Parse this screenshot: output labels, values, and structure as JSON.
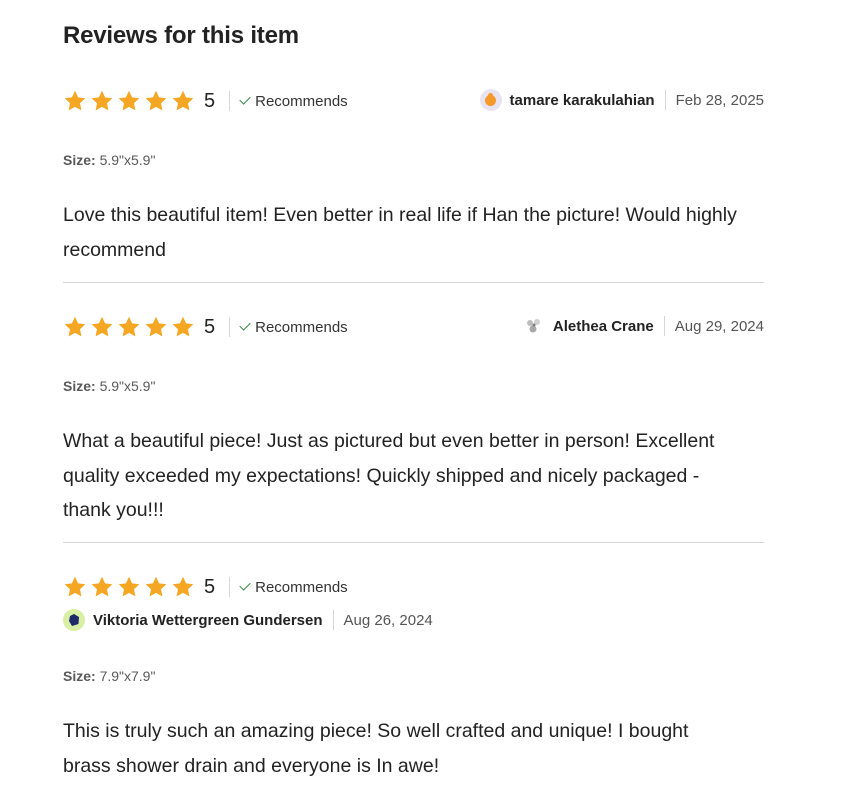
{
  "heading": "Reviews for this item",
  "star_color": "#f5a623",
  "reviews": [
    {
      "rating": "5",
      "recommends": "Recommends",
      "reviewer": "tamare karakulahian",
      "date": "Feb 28, 2025",
      "size_label": "Size:",
      "size_value": "5.9\"x5.9\"",
      "text": "Love this beautiful item! Even better in real life if Han the picture! Would highly recommend"
    },
    {
      "rating": "5",
      "recommends": "Recommends",
      "reviewer": "Alethea Crane",
      "date": "Aug 29, 2024",
      "size_label": "Size:",
      "size_value": "5.9\"x5.9\"",
      "text": "What a beautiful piece! Just as pictured but even better in person! Excellent quality exceeded my expectations! Quickly shipped and nicely packaged - thank you!!!"
    },
    {
      "rating": "5",
      "recommends": "Recommends",
      "reviewer": "Viktoria Wettergreen Gundersen",
      "date": "Aug 26, 2024",
      "size_label": "Size:",
      "size_value": "7.9\"x7.9\"",
      "text": "This is truly such an amazing piece! So well crafted and unique! I bought brass shower drain and everyone is In awe!"
    }
  ]
}
